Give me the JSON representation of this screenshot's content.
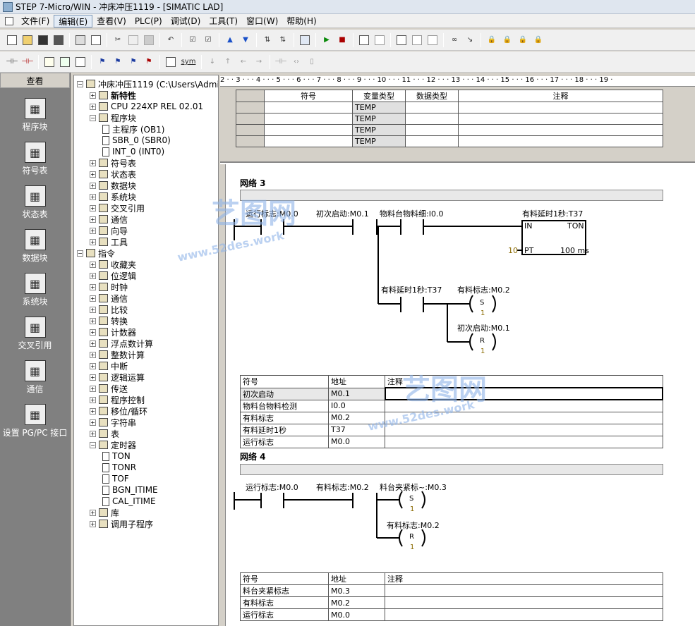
{
  "window": {
    "title": "STEP 7-Micro/WIN - 冲床冲压1119 - [SIMATIC LAD]"
  },
  "menu": [
    "文件(F)",
    "编辑(E)",
    "查看(V)",
    "PLC(P)",
    "调试(D)",
    "工具(T)",
    "窗口(W)",
    "帮助(H)"
  ],
  "toolbar2": {
    "sym": "sym"
  },
  "nav": {
    "header": "查看",
    "items": [
      {
        "label": "程序块",
        "icon": "program-block-icon"
      },
      {
        "label": "符号表",
        "icon": "symbol-table-icon"
      },
      {
        "label": "状态表",
        "icon": "status-table-icon"
      },
      {
        "label": "数据块",
        "icon": "data-block-icon"
      },
      {
        "label": "系统块",
        "icon": "system-block-icon"
      },
      {
        "label": "交叉引用",
        "icon": "cross-reference-icon"
      },
      {
        "label": "通信",
        "icon": "communication-icon"
      },
      {
        "label": "设置 PG/PC 接口",
        "icon": "pgpc-interface-icon"
      }
    ]
  },
  "tree": [
    {
      "label": "冲床冲压1119 (C:\\Users\\Adminis",
      "lvl": 0
    },
    {
      "label": "新特性",
      "lvl": 1
    },
    {
      "label": "CPU 224XP REL 02.01",
      "lvl": 1
    },
    {
      "label": "程序块",
      "lvl": 1
    },
    {
      "label": "主程序 (OB1)",
      "lvl": 2
    },
    {
      "label": "SBR_0 (SBR0)",
      "lvl": 2
    },
    {
      "label": "INT_0 (INT0)",
      "lvl": 2
    },
    {
      "label": "符号表",
      "lvl": 1
    },
    {
      "label": "状态表",
      "lvl": 1
    },
    {
      "label": "数据块",
      "lvl": 1
    },
    {
      "label": "系统块",
      "lvl": 1
    },
    {
      "label": "交叉引用",
      "lvl": 1
    },
    {
      "label": "通信",
      "lvl": 1
    },
    {
      "label": "向导",
      "lvl": 1
    },
    {
      "label": "工具",
      "lvl": 1
    },
    {
      "label": "指令",
      "lvl": 0
    },
    {
      "label": "收藏夹",
      "lvl": 1
    },
    {
      "label": "位逻辑",
      "lvl": 1
    },
    {
      "label": "时钟",
      "lvl": 1
    },
    {
      "label": "通信",
      "lvl": 1
    },
    {
      "label": "比较",
      "lvl": 1
    },
    {
      "label": "转换",
      "lvl": 1
    },
    {
      "label": "计数器",
      "lvl": 1
    },
    {
      "label": "浮点数计算",
      "lvl": 1
    },
    {
      "label": "整数计算",
      "lvl": 1
    },
    {
      "label": "中断",
      "lvl": 1
    },
    {
      "label": "逻辑运算",
      "lvl": 1
    },
    {
      "label": "传送",
      "lvl": 1
    },
    {
      "label": "程序控制",
      "lvl": 1
    },
    {
      "label": "移位/循环",
      "lvl": 1
    },
    {
      "label": "字符串",
      "lvl": 1
    },
    {
      "label": "表",
      "lvl": 1
    },
    {
      "label": "定时器",
      "lvl": 1
    },
    {
      "label": "TON",
      "lvl": 2
    },
    {
      "label": "TONR",
      "lvl": 2
    },
    {
      "label": "TOF",
      "lvl": 2
    },
    {
      "label": "BGN_ITIME",
      "lvl": 2
    },
    {
      "label": "CAL_ITIME",
      "lvl": 2
    },
    {
      "label": "库",
      "lvl": 1
    },
    {
      "label": "调用子程序",
      "lvl": 1
    }
  ],
  "ruler": "2 · · 3 · · · 4 · · · 5 · · · 6 · · · 7 · · · 8 · · · 9 · · · 10 · · · 11 · · · 12 · · · 13 · · · 14 · · · 15 · · · 16 · · · 17 · · · 18 · · · 19 ·",
  "local_vars": {
    "headers": [
      "符号",
      "变量类型",
      "数据类型",
      "注释"
    ],
    "rows": [
      "TEMP",
      "TEMP",
      "TEMP",
      "TEMP"
    ]
  },
  "network3": {
    "title": "网络 3",
    "c1": "运行标志:M0.0",
    "c2": "初次启动:M0.1",
    "c3": "物料台物料细:I0.0",
    "timer": "有料延时1秒:T37",
    "tin": "IN",
    "tton": "TON",
    "tpt": "PT",
    "tpv": "10",
    "tbase": "100 ms",
    "c4": "有料延时1秒:T37",
    "coil1": "有料标志:M0.2",
    "coil1t": "S",
    "coil1n": "1",
    "coil2": "初次启动:M0.1",
    "coil2t": "R",
    "coil2n": "1",
    "sym_headers": [
      "符号",
      "地址",
      "注释"
    ],
    "sym_rows": [
      [
        "初次启动",
        "M0.1"
      ],
      [
        "物料台物料检测",
        "I0.0"
      ],
      [
        "有料标志",
        "M0.2"
      ],
      [
        "有料延时1秒",
        "T37"
      ],
      [
        "运行标志",
        "M0.0"
      ]
    ]
  },
  "network4": {
    "title": "网络 4",
    "c1": "运行标志:M0.0",
    "c2": "有料标志:M0.2",
    "coil1": "料台夹紧标~:M0.3",
    "coil1t": "S",
    "coil1n": "1",
    "coil2": "有料标志:M0.2",
    "coil2t": "R",
    "coil2n": "1",
    "sym_headers": [
      "符号",
      "地址",
      "注释"
    ],
    "sym_rows": [
      [
        "料台夹紧标志",
        "M0.3"
      ],
      [
        "有料标志",
        "M0.2"
      ],
      [
        "运行标志",
        "M0.0"
      ]
    ]
  },
  "watermark": {
    "cn": "艺图网",
    "url": "www.52des.work"
  }
}
